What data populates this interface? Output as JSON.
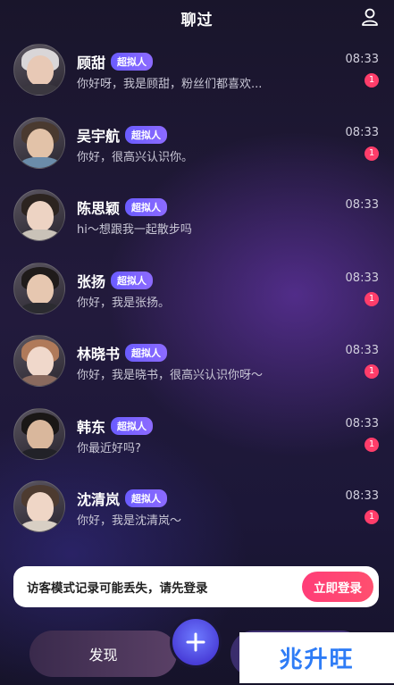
{
  "header": {
    "title": "聊过"
  },
  "chats": [
    {
      "name": "顾甜",
      "tag": "超拟人",
      "message": "你好呀，我是顾甜，粉丝们都喜欢...",
      "time": "08:33",
      "unread": "1",
      "skin": "#e8c9b6",
      "hair": "#d9d6d8",
      "body": "#3b3840"
    },
    {
      "name": "吴宇航",
      "tag": "超拟人",
      "message": "你好，很高兴认识你。",
      "time": "08:33",
      "unread": "1",
      "skin": "#e2c2a8",
      "hair": "#4a3a30",
      "body": "#6b8caa"
    },
    {
      "name": "陈思颖",
      "tag": "超拟人",
      "message": "hi～想跟我一起散步吗",
      "time": "08:33",
      "unread": "",
      "skin": "#edd3c3",
      "hair": "#2c2420",
      "body": "#c9c2b8"
    },
    {
      "name": "张扬",
      "tag": "超拟人",
      "message": "你好，我是张扬。",
      "time": "08:33",
      "unread": "1",
      "skin": "#e6c7b0",
      "hair": "#1f1b1a",
      "body": "#2b2b30"
    },
    {
      "name": "林晓书",
      "tag": "超拟人",
      "message": "你好，我是晓书，很高兴认识你呀～",
      "time": "08:33",
      "unread": "1",
      "skin": "#f0d8cb",
      "hair": "#b07a5a",
      "body": "#8a6a5e"
    },
    {
      "name": "韩东",
      "tag": "超拟人",
      "message": "你最近好吗?",
      "time": "08:33",
      "unread": "1",
      "skin": "#d9b79c",
      "hair": "#1a1716",
      "body": "#222228"
    },
    {
      "name": "沈清岚",
      "tag": "超拟人",
      "message": "你好，我是沈清岚～",
      "time": "08:33",
      "unread": "1",
      "skin": "#efd6c6",
      "hair": "#4d3b30",
      "body": "#d8cfc4"
    }
  ],
  "toast": {
    "text": "访客模式记录可能丢失，请先登录",
    "button": "立即登录"
  },
  "nav": {
    "discover": "发现"
  },
  "watermark": "兆升旺",
  "colors": {
    "accent": "#ff3d6a",
    "tag": "#6a5cff",
    "badge": "#ff3d6a"
  }
}
